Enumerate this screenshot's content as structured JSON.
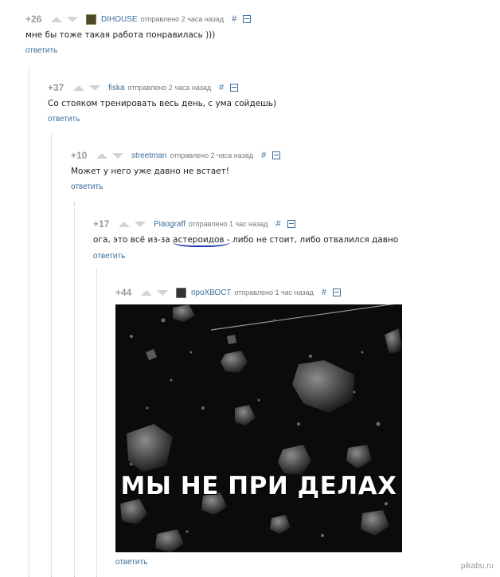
{
  "comments": [
    {
      "rating": "+26",
      "user": "DIHOUSE",
      "meta": "отправлено 2 часа назад",
      "hash": "#",
      "text": "мне бы тоже такая работа понравилась )))",
      "reply": "ответить"
    },
    {
      "rating": "+37",
      "user": "fiska",
      "meta": "отправлено 2 часа назад",
      "hash": "#",
      "text": "Со стояком тренировать весь день, с ума сойдешь)",
      "reply": "ответить"
    },
    {
      "rating": "+10",
      "user": "streetman",
      "meta": "отправлено 2 часа назад",
      "hash": "#",
      "text": "Может у него уже давно не встает!",
      "reply": "ответить"
    },
    {
      "rating": "+17",
      "user": "Piaograff",
      "meta": "отправлено 1 час назад",
      "hash": "#",
      "text_before": "ога, это всё из-за ",
      "text_mark": "астероидов -",
      "text_after": " либо не стоит, либо отвалился давно",
      "reply": "ответить"
    },
    {
      "rating": "+44",
      "user": "проХВОСТ",
      "meta": "отправлено 1 час назад",
      "hash": "#",
      "image_caption": "МЫ НЕ ПРИ ДЕЛАХ",
      "reply": "ответить"
    }
  ],
  "watermark": "pikabu.ru",
  "colors": {
    "link": "#3b6e9b",
    "rating": "#9a9a9a",
    "arrows": "#cfd4d8",
    "underline": "#1f3fb0"
  }
}
